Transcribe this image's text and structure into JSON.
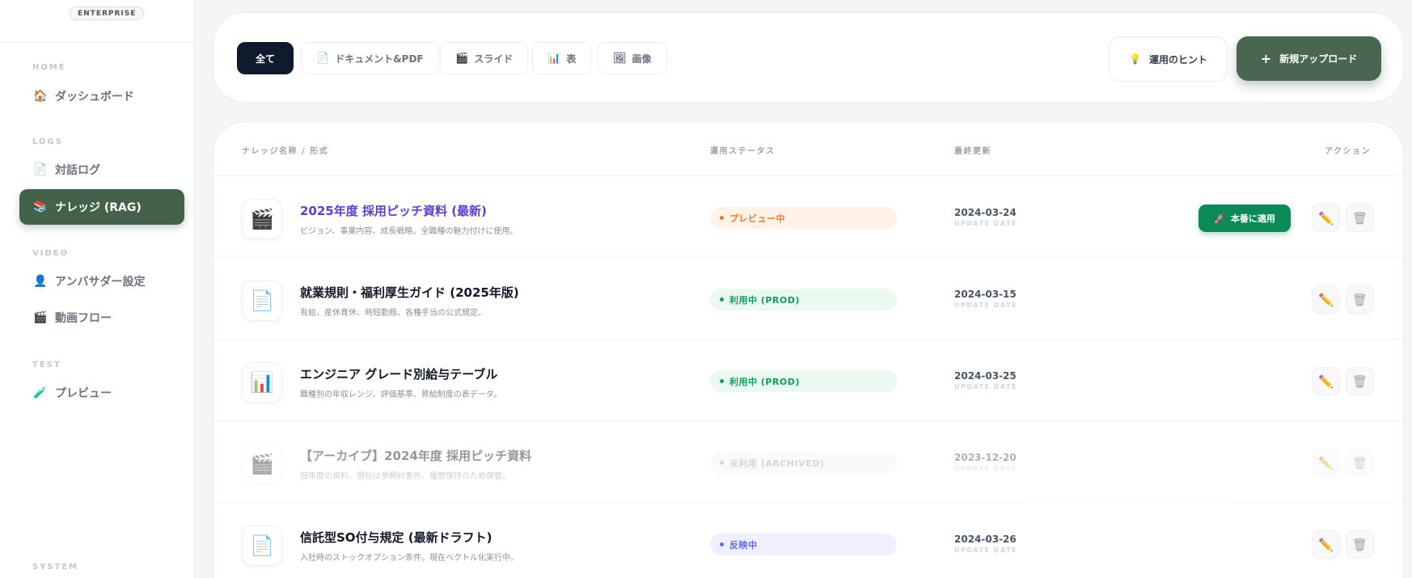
{
  "brand": {
    "badge": "ENTERPRISE"
  },
  "sidebar": {
    "sections": [
      {
        "label": "HOME"
      },
      {
        "label": "LOGS"
      },
      {
        "label": "VIDEO"
      },
      {
        "label": "TEST"
      },
      {
        "label": "SYSTEM"
      }
    ],
    "items": [
      {
        "label": "ダッシュボード",
        "icon": "house-icon",
        "glyph": "🏠"
      },
      {
        "label": "対話ログ",
        "icon": "document-icon",
        "glyph": "📄"
      },
      {
        "label": "ナレッジ (RAG)",
        "icon": "books-icon",
        "glyph": "📚"
      },
      {
        "label": "アンバサダー設定",
        "icon": "user-icon",
        "glyph": "👤"
      },
      {
        "label": "動画フロー",
        "icon": "clapper-icon",
        "glyph": "🎬"
      },
      {
        "label": "プレビュー",
        "icon": "pipette-icon",
        "glyph": "🧪"
      }
    ]
  },
  "filters": [
    {
      "label": "全て",
      "icon": ""
    },
    {
      "label": "ドキュメント&PDF",
      "glyph": "📄"
    },
    {
      "label": "スライド",
      "glyph": "🎬"
    },
    {
      "label": "表",
      "glyph": "📊"
    },
    {
      "label": "画像",
      "glyph": "🖼"
    }
  ],
  "toolbar": {
    "hint_label": "運用のヒント",
    "hint_glyph": "💡",
    "upload_label": "新規アップロード",
    "upload_glyph": "+"
  },
  "table": {
    "headers": {
      "name": "ナレッジ名称 / 形式",
      "status": "運用ステータス",
      "updated": "最終更新",
      "actions": "アクション"
    },
    "date_sub_label": "UPDATE DATE",
    "apply_label": "本番に適用",
    "apply_glyph": "🚀",
    "edit_glyph": "✏️",
    "delete_glyph": "🗑",
    "rows": [
      {
        "glyph": "🎬",
        "title": "2025年度 採用ピッチ資料 (最新)",
        "desc": "ビジョン、事業内容、成長戦略。全職種の魅力付けに使用。",
        "status": "プレビュー中",
        "status_color": "#ea7a23",
        "status_bg": "#fff3e8",
        "date": "2024-03-24"
      },
      {
        "glyph": "📄",
        "title": "就業規則・福利厚生ガイド (2025年版)",
        "desc": "有給、産休育休、時短勤務、各種手当の公式規定。",
        "status": "利用中 (PROD)",
        "status_color": "#0f9d58",
        "status_bg": "#eafaf0",
        "date": "2024-03-15"
      },
      {
        "glyph": "📊",
        "title": "エンジニア グレード別給与テーブル",
        "desc": "職種別の年収レンジ、評価基準、昇給制度の表データ。",
        "status": "利用中 (PROD)",
        "status_color": "#0f9d58",
        "status_bg": "#eafaf0",
        "date": "2024-03-25"
      },
      {
        "glyph": "🎬",
        "title": "【アーカイブ】2024年度 採用ピッチ資料",
        "desc": "旧年度の資料。現在は参照対象外。履歴保持のため保管。",
        "status": "未利用 (ARCHIVED)",
        "status_color": "#9ca3af",
        "status_bg": "#f3f4f6",
        "date": "2023-12-20"
      },
      {
        "glyph": "📄",
        "title": "信託型SO付与規定 (最新ドラフト)",
        "desc": "入社時のストックオプション条件。現在ベクトル化実行中。",
        "status": "反映中",
        "status_color": "#6366f1",
        "status_bg": "#eef0ff",
        "date": "2024-03-26"
      }
    ]
  }
}
